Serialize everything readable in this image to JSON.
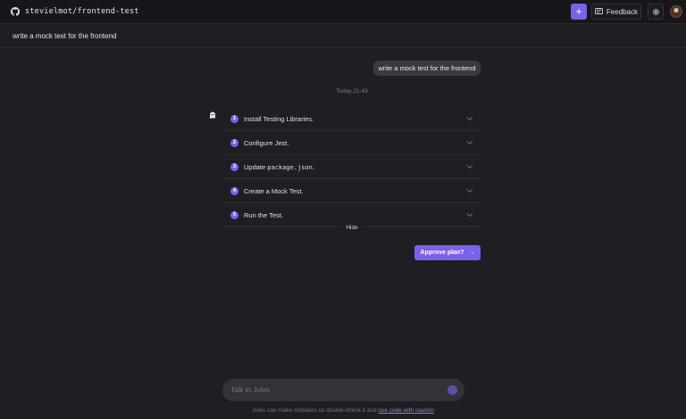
{
  "header": {
    "repo_name": "stevielmot/frontend-test",
    "new_button_label": "+",
    "feedback_label": "Feedback"
  },
  "task": {
    "title": "write a mock test for the frontend"
  },
  "conversation": {
    "user_message": "write a mock test for the frontend",
    "timestamp": "Today 21:43"
  },
  "plan": {
    "steps": [
      {
        "num": "1",
        "label": "Install Testing Libraries."
      },
      {
        "num": "2",
        "label": "Configure Jest."
      },
      {
        "num": "3",
        "label_prefix": "Update ",
        "label_code": "package.json",
        "label_suffix": "."
      },
      {
        "num": "4",
        "label": "Create a Mock Test."
      },
      {
        "num": "5",
        "label": "Run the Test."
      }
    ],
    "hide_label": "Hide",
    "approve_label": "Approve plan?",
    "approve_arrow": "→"
  },
  "composer": {
    "placeholder": "Talk to Jules"
  },
  "footer": {
    "disclaimer_text": "Jules can make mistakes so double-check it and ",
    "disclaimer_link": "use code with caution"
  },
  "colors": {
    "accent": "#7b61e8",
    "background": "#1f1e23",
    "topbar": "#17161a"
  }
}
